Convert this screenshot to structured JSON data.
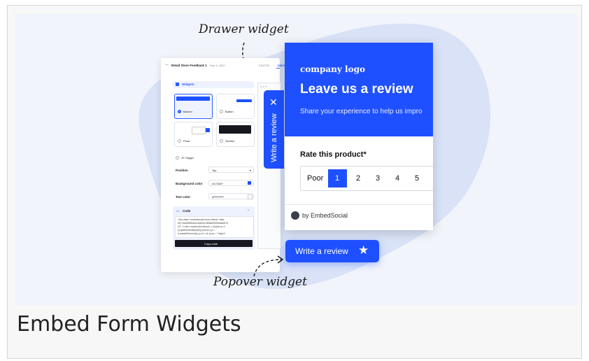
{
  "caption": "Embed Form Widgets",
  "colors": {
    "brand_blue": "#1e50ff",
    "blob": "#d9e2f7",
    "hero_bg": "#f1f4fa"
  },
  "annotations": {
    "drawer": "Drawer widget",
    "popover": "Popover widget"
  },
  "editor": {
    "title": "Retail Store Feedback 1",
    "date": "Sep 4, 2020",
    "tabs": [
      "EDITOR",
      "WIDG"
    ],
    "section_title": "Widgets",
    "options": [
      "Banner",
      "Button",
      "Float",
      "Section",
      "JS Trigger"
    ],
    "button_mini_label": "Write a review",
    "position_label": "Position",
    "position_value": "Top",
    "bg_label": "Background color",
    "bg_value": "#17181F",
    "text_label": "Text color",
    "text_value": "#FFFFFF",
    "code_title": "Code",
    "code_lines": [
      "<div class=\"embedsocial-forms-iframe\" data-",
      "ref=\"bfaef5f9eaed1a4ed11489afe5f09eea8e676",
      "24\" ></div><script>(function(d, s, id){var js; if",
      "(d.getElementById(id)) {return;} js =",
      "d.createElement(s); js.id = id; js.src = \"https://"
    ],
    "copy_button": "Copy code"
  },
  "drawer_tab": {
    "close_icon": "✕",
    "label": "Write a review"
  },
  "review_card": {
    "logo": "company logo",
    "heading": "Leave us a review",
    "subtext": "Share your experience to help us impro",
    "rate_label": "Rate this product*",
    "scale_label": "Poor",
    "scale": [
      "1",
      "2",
      "3",
      "4",
      "5"
    ],
    "footer": "by EmbedSocial"
  },
  "popover_button": {
    "label": "Write a review",
    "icon": "★"
  }
}
